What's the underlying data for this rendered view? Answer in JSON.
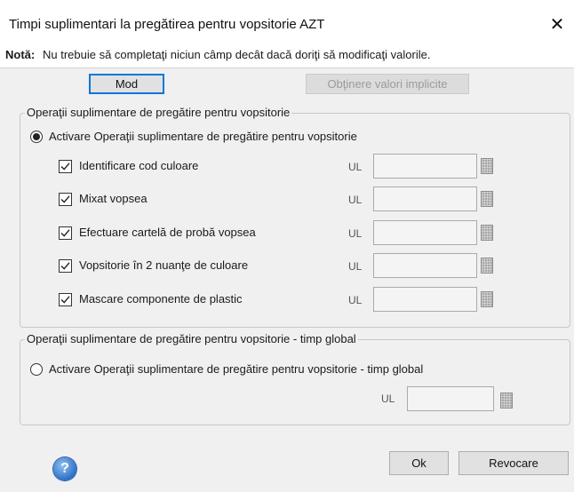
{
  "dialog": {
    "title": "Timpi suplimentari la pregătirea pentru vopsitorie AZT",
    "close_glyph": "✕",
    "note_label": "Notă:",
    "note_text": "Nu trebuie să completaţi niciun câmp decât dacă doriţi să modificaţi valorile."
  },
  "toolbar": {
    "mod_label": "Mod",
    "defaults_label": "Obţinere valori implicite"
  },
  "group1": {
    "title": "Operaţii suplimentare de pregătire pentru vopsitorie",
    "radio_label": "Activare Operaţii suplimentare de pregătire pentru vopsitorie",
    "radio_checked": true,
    "items": [
      {
        "label": "Identificare cod culoare",
        "checked": true,
        "unit": "UL",
        "value": ""
      },
      {
        "label": "Mixat vopsea",
        "checked": true,
        "unit": "UL",
        "value": ""
      },
      {
        "label": "Efectuare cartelă de probă vopsea",
        "checked": true,
        "unit": "UL",
        "value": ""
      },
      {
        "label": "Vopsitorie în 2 nuanţe de culoare",
        "checked": true,
        "unit": "UL",
        "value": ""
      },
      {
        "label": "Mascare componente de plastic",
        "checked": true,
        "unit": "UL",
        "value": ""
      }
    ]
  },
  "group2": {
    "title": "Operaţii suplimentare de pregătire pentru vopsitorie - timp global",
    "radio_label": "Activare Operaţii suplimentare de pregătire pentru vopsitorie - timp global",
    "radio_checked": false,
    "unit": "UL",
    "value": ""
  },
  "footer": {
    "help_glyph": "?",
    "ok_label": "Ok",
    "cancel_label": "Revocare"
  },
  "colors": {
    "accent": "#0078d7",
    "dialog_bg": "#f0f0f0"
  },
  "icons": {
    "help": "help-icon",
    "close": "close-icon",
    "checkbox": "checkmark-icon",
    "field_picker": "picker-grid-icon"
  }
}
